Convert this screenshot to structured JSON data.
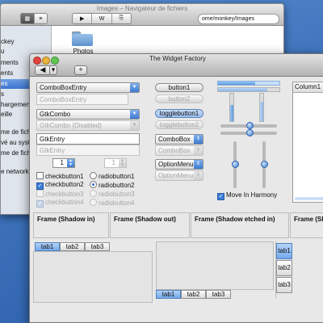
{
  "file_manager": {
    "title": "Images – Navigateur de fichiers",
    "location": "ome/monkey/Images",
    "sidebar_items": [
      "ckey",
      "u",
      "ments",
      "ents",
      "es",
      "s",
      "hargement",
      "eille",
      "",
      "me de fichi",
      "vé au syst",
      "me de fichi",
      "",
      "e network"
    ],
    "selected_sidebar_index": 4,
    "folder_name": "Photos"
  },
  "widget_factory": {
    "title": "The Widget Factory",
    "left": {
      "combo_entry": "ComboBoxEntry",
      "combo_entry_disabled": "ComboBoxEntry",
      "gtk_combo": "GtkCombo",
      "gtk_combo_disabled": "GtkCombo (Disabled)",
      "gtk_entry": "GtkEntry",
      "gtk_entry_disabled": "GtkEntry",
      "spin_value": "1",
      "spin_disabled_value": "1",
      "checks": [
        "checkbutton1",
        "checkbutton2",
        "checkbutton3",
        "checkbutton4"
      ],
      "radios": [
        "radiobutton1",
        "radiobutton2",
        "radiobutton3",
        "radiobutton4"
      ]
    },
    "middle": {
      "button1": "button1",
      "button2": "button2",
      "toggle1": "togglebutton1",
      "toggle2": "togglebutton2",
      "combobox": "ComboBox",
      "combobox_disabled": "ComboBox",
      "optionmenu": "OptionMenu",
      "optionmenu_disabled": "OptionMenu"
    },
    "right": {
      "move_in_harmony": "Move In Harmony",
      "tree_column": "Column1"
    },
    "frames": [
      "Frame (Shadow in)",
      "Frame (Shadow out)",
      "Frame (Shadow etched in)",
      "Frame (Shado"
    ],
    "top_tabs": [
      "tab1",
      "tab2",
      "tab3"
    ],
    "bottom_tabs": [
      "tab1",
      "tab2",
      "tab3"
    ],
    "side_tabs": [
      "tab1",
      "tab2",
      "tab3"
    ]
  }
}
